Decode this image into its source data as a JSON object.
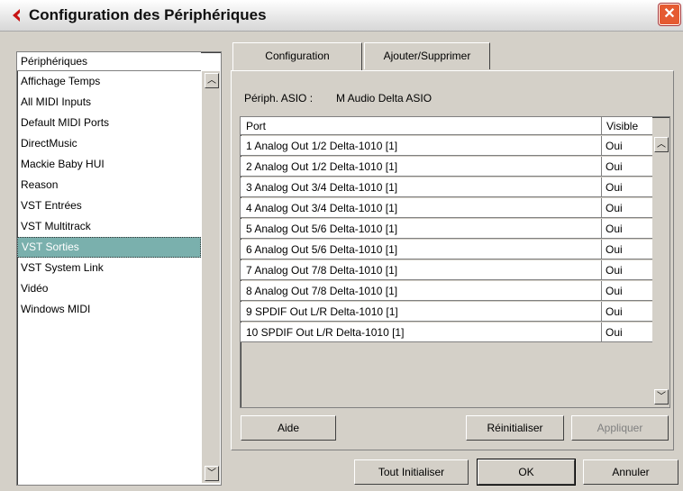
{
  "window": {
    "title": "Configuration des Périphériques",
    "close_icon": "close-icon",
    "logo_icon": "cubase-logo-icon",
    "accent": "#7ab0ad"
  },
  "devices": {
    "header": "Périphériques",
    "items": [
      "Affichage Temps",
      "All MIDI Inputs",
      "Default MIDI Ports",
      "DirectMusic",
      "Mackie Baby HUI",
      "Reason",
      "VST Entrées",
      "VST Multitrack",
      "VST Sorties",
      "VST System Link",
      "Vidéo",
      "Windows MIDI"
    ],
    "selected": "VST Sorties"
  },
  "tabs": [
    "Configuration",
    "Ajouter/Supprimer"
  ],
  "active_tab": "Configuration",
  "asio": {
    "label": "Périph. ASIO :",
    "value": "M Audio Delta ASIO"
  },
  "table": {
    "columns": [
      "Port",
      "Visible"
    ],
    "rows": [
      {
        "port": "1 Analog Out 1/2 Delta-1010 [1]",
        "visible": "Oui"
      },
      {
        "port": "2 Analog Out 1/2 Delta-1010 [1]",
        "visible": "Oui"
      },
      {
        "port": "3 Analog Out 3/4 Delta-1010 [1]",
        "visible": "Oui"
      },
      {
        "port": "4 Analog Out 3/4 Delta-1010 [1]",
        "visible": "Oui"
      },
      {
        "port": "5 Analog Out 5/6 Delta-1010 [1]",
        "visible": "Oui"
      },
      {
        "port": "6 Analog Out 5/6 Delta-1010 [1]",
        "visible": "Oui"
      },
      {
        "port": "7 Analog Out 7/8 Delta-1010 [1]",
        "visible": "Oui"
      },
      {
        "port": "8 Analog Out 7/8 Delta-1010 [1]",
        "visible": "Oui"
      },
      {
        "port": "9 SPDIF Out L/R Delta-1010 [1]",
        "visible": "Oui"
      },
      {
        "port": "10 SPDIF Out L/R Delta-1010 [1]",
        "visible": "Oui"
      }
    ]
  },
  "panel_buttons": {
    "help": "Aide",
    "reset": "Réinitialiser",
    "apply": "Appliquer"
  },
  "footer_buttons": {
    "reset_all": "Tout Initialiser",
    "ok": "OK",
    "cancel": "Annuler"
  }
}
